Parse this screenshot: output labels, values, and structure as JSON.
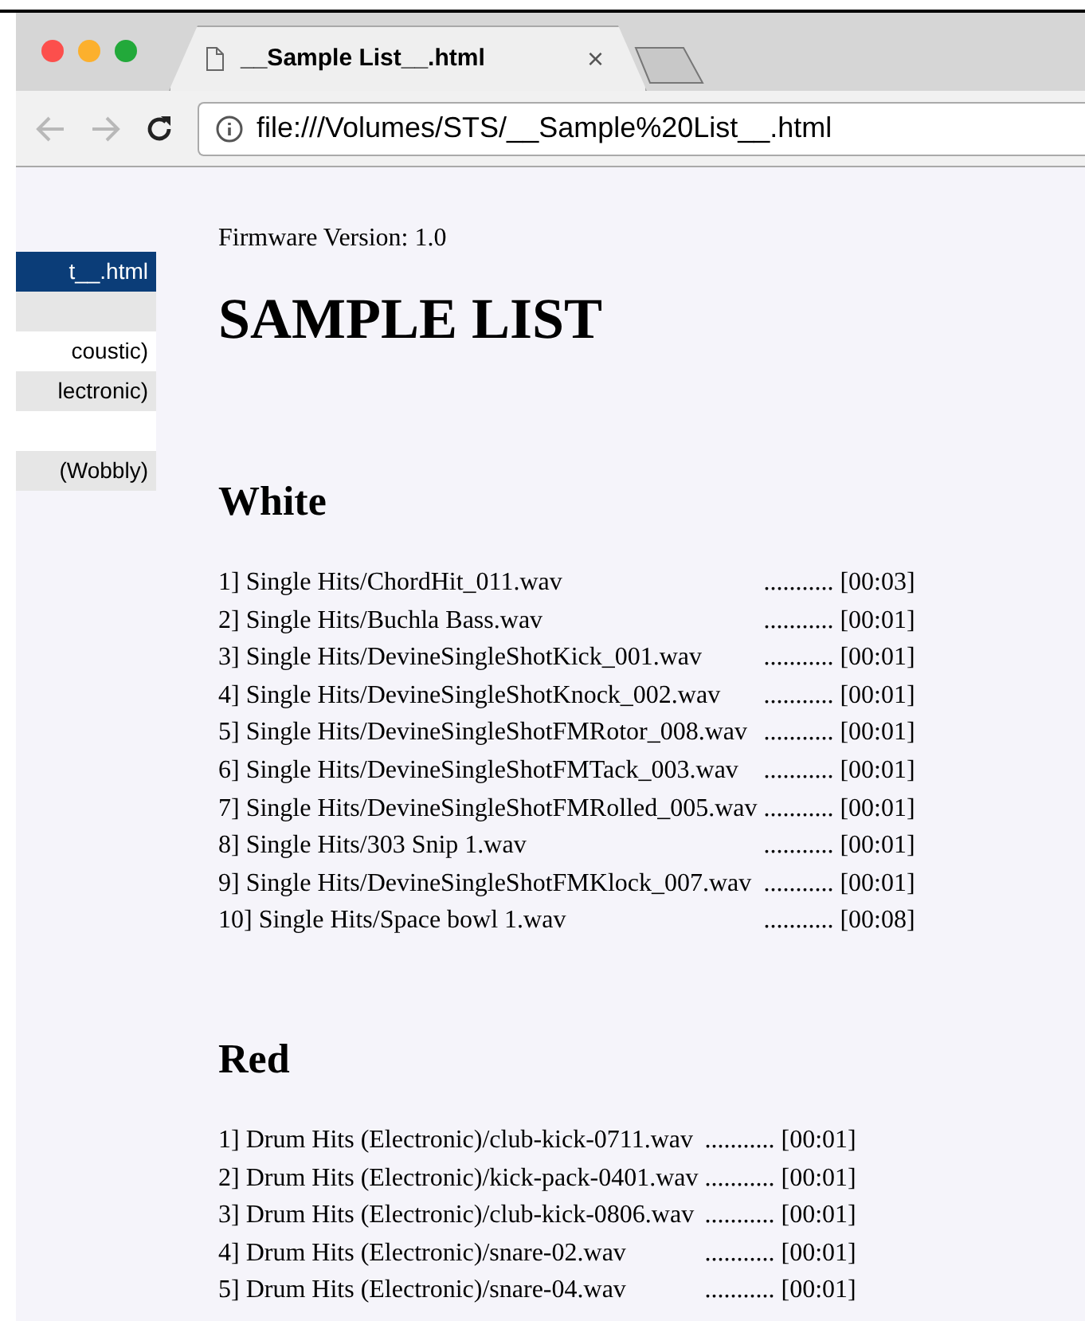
{
  "tab": {
    "title": "__Sample List__.html",
    "close": "×"
  },
  "address_bar": {
    "url": "file:///Volumes/STS/__Sample%20List__.html"
  },
  "sidebar": {
    "items": [
      {
        "label": "t__.html",
        "selected": true
      },
      {
        "selected": false
      },
      {
        "label": "coustic)",
        "selected": false
      },
      {
        "label": "lectronic)",
        "selected": false
      },
      {
        "selected": false
      },
      {
        "label": "(Wobbly)",
        "selected": false
      }
    ]
  },
  "firmware": "Firmware Version: 1.0",
  "title": "SAMPLE LIST",
  "sections": [
    {
      "heading": "White",
      "rows": [
        {
          "name": "1] Single Hits/ChordHit_011.wav",
          "duration": "........... [00:03]"
        },
        {
          "name": "2] Single Hits/Buchla Bass.wav",
          "duration": "........... [00:01]"
        },
        {
          "name": "3] Single Hits/DevineSingleShotKick_001.wav",
          "duration": "........... [00:01]"
        },
        {
          "name": "4] Single Hits/DevineSingleShotKnock_002.wav",
          "duration": "........... [00:01]"
        },
        {
          "name": "5] Single Hits/DevineSingleShotFMRotor_008.wav",
          "duration": "........... [00:01]"
        },
        {
          "name": "6] Single Hits/DevineSingleShotFMTack_003.wav",
          "duration": "........... [00:01]"
        },
        {
          "name": "7] Single Hits/DevineSingleShotFMRolled_005.wav",
          "duration": "........... [00:01]"
        },
        {
          "name": "8] Single Hits/303 Snip 1.wav",
          "duration": "........... [00:01]"
        },
        {
          "name": "9] Single Hits/DevineSingleShotFMKlock_007.wav",
          "duration": "........... [00:01]"
        },
        {
          "name": "10] Single Hits/Space bowl 1.wav",
          "duration": "........... [00:08]"
        }
      ]
    },
    {
      "heading": "Red",
      "rows": [
        {
          "name": "1] Drum Hits (Electronic)/club-kick-0711.wav",
          "duration": "........... [00:01]"
        },
        {
          "name": "2] Drum Hits (Electronic)/kick-pack-0401.wav",
          "duration": "........... [00:01]"
        },
        {
          "name": "3] Drum Hits (Electronic)/club-kick-0806.wav",
          "duration": "........... [00:01]"
        },
        {
          "name": "4] Drum Hits (Electronic)/snare-02.wav",
          "duration": "........... [00:01]"
        },
        {
          "name": "5] Drum Hits (Electronic)/snare-04.wav",
          "duration": "........... [00:01]"
        }
      ]
    }
  ]
}
